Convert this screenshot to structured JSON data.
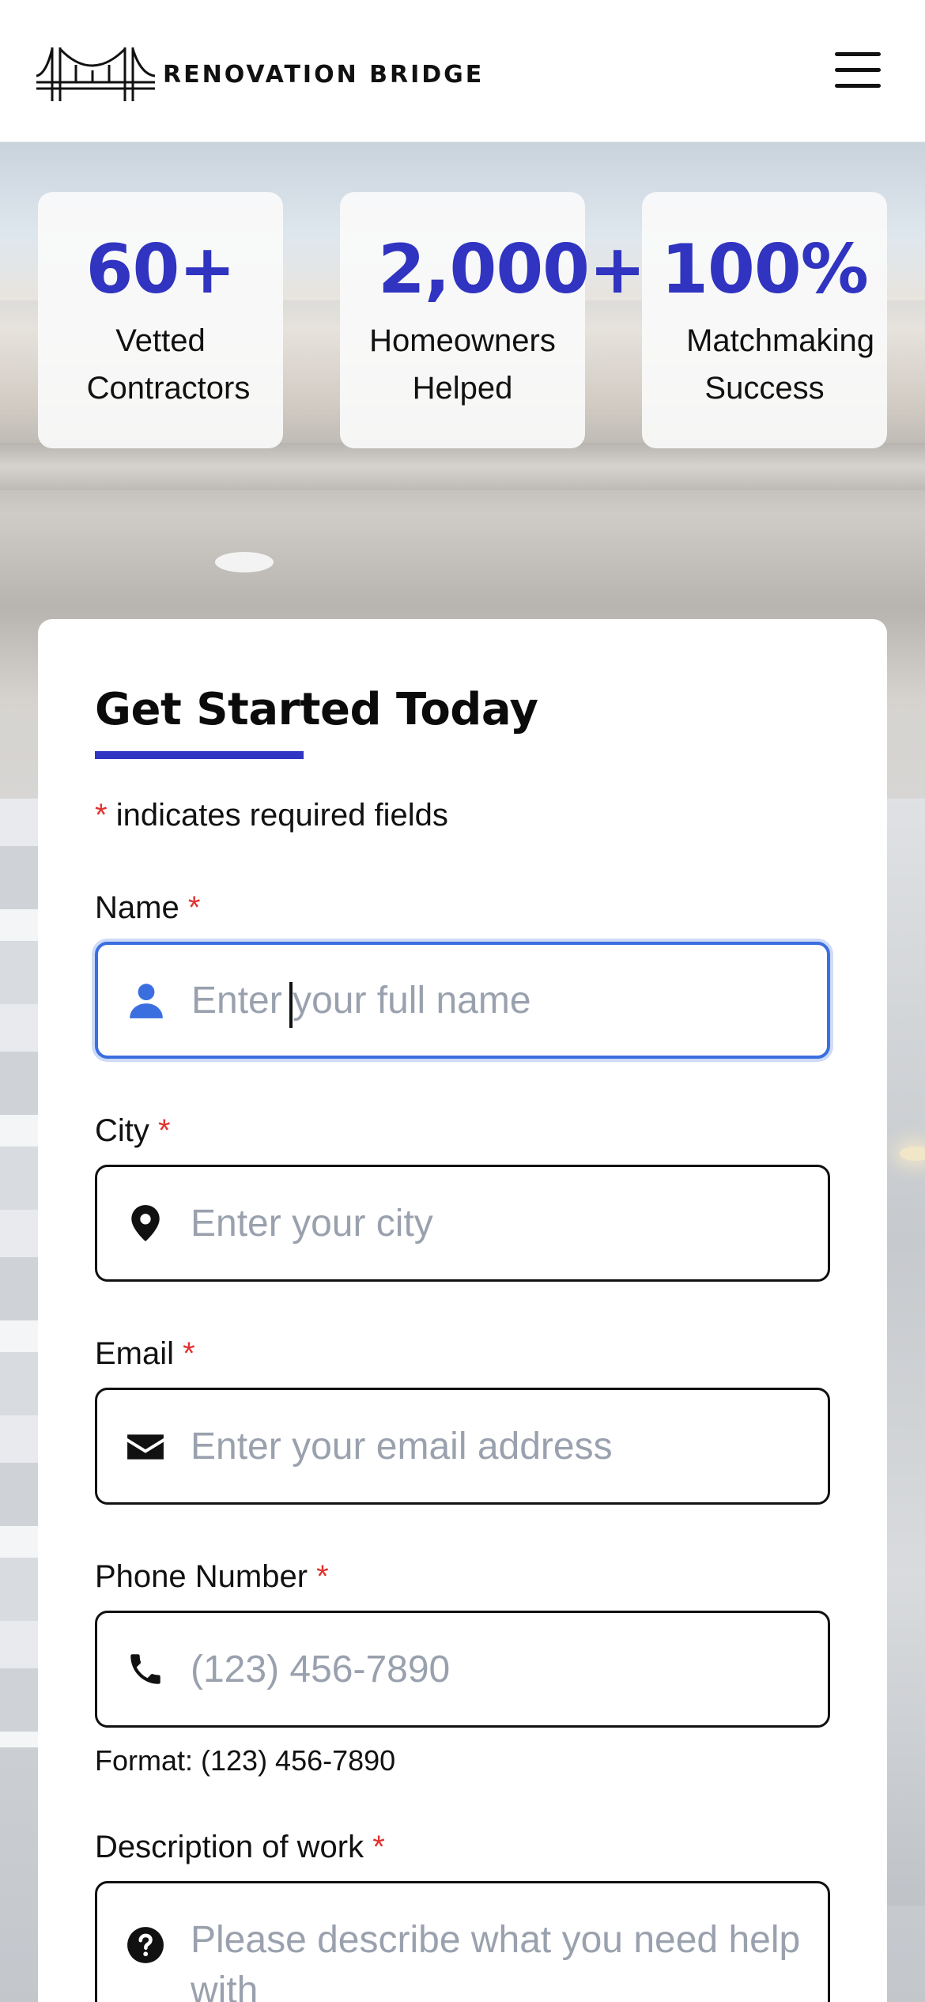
{
  "header": {
    "logo_text": "RENOVATION BRIDGE"
  },
  "stats": [
    {
      "number": "60+",
      "label_line1": "Vetted",
      "label_line2": "Contractors"
    },
    {
      "number": "2,000+",
      "label_line1": "Homeowners",
      "label_line2": "Helped"
    },
    {
      "number": "100%",
      "label_line1": "Matchmaking",
      "label_line2": "Success"
    }
  ],
  "form": {
    "title": "Get Started Today",
    "required_star": "*",
    "required_note": " indicates required fields",
    "fields": {
      "name": {
        "label": "Name",
        "placeholder": "Enter your full name"
      },
      "city": {
        "label": "City",
        "placeholder": "Enter your city"
      },
      "email": {
        "label": "Email",
        "placeholder": "Enter your email address"
      },
      "phone": {
        "label": "Phone Number",
        "placeholder": "(123) 456-7890",
        "hint": "Format: (123) 456-7890"
      },
      "description": {
        "label": "Description of work",
        "placeholder": "Please describe what you need help with"
      }
    }
  },
  "colors": {
    "accent": "#3034c0",
    "required": "#e0322f",
    "focus": "#3b6fe0"
  },
  "icons": {
    "name": "user-icon",
    "city": "map-pin-icon",
    "email": "envelope-icon",
    "phone": "phone-icon",
    "description": "question-circle-icon"
  }
}
